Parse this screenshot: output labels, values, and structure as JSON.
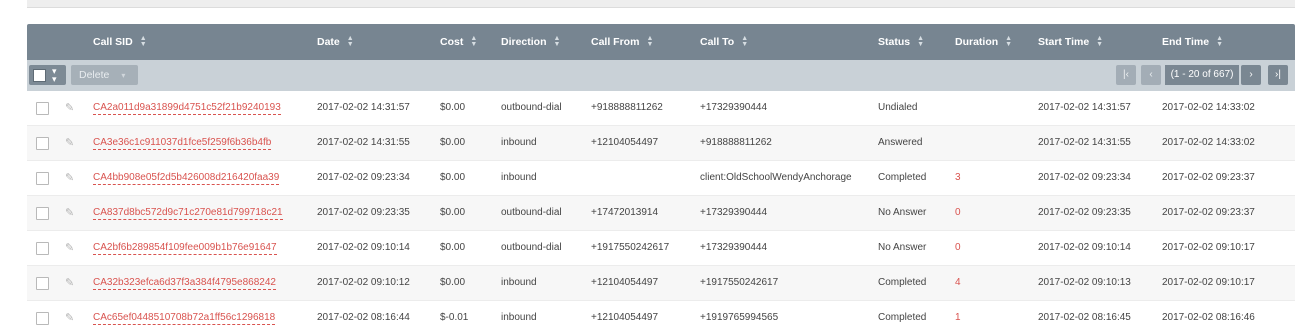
{
  "columns": {
    "call_sid": "Call SID",
    "date": "Date",
    "cost": "Cost",
    "direction": "Direction",
    "call_from": "Call From",
    "call_to": "Call To",
    "status": "Status",
    "duration": "Duration",
    "start_time": "Start Time",
    "end_time": "End Time"
  },
  "toolbar": {
    "delete_label": "Delete",
    "pagination_label": "(1 - 20 of 667)"
  },
  "icons": {
    "sort": "sort-arrows-icon",
    "edit": "pencil-icon",
    "first": "first-page-icon",
    "prev": "previous-page-icon",
    "next": "next-page-icon",
    "last": "last-page-icon"
  },
  "colors": {
    "header_bg": "#778591",
    "toolbar_bg": "#c9d1d7",
    "link": "#d9534f"
  },
  "rows": [
    {
      "sid": "CA2a011d9a31899d4751c52f21b9240193",
      "date": "2017-02-02 14:31:57",
      "cost": "$0.00",
      "direction": "outbound-dial",
      "from": "+918888811262",
      "to": "+17329390444",
      "status": "Undialed",
      "duration": "",
      "start": "2017-02-02 14:31:57",
      "end": "2017-02-02 14:33:02"
    },
    {
      "sid": "CA3e36c1c911037d1fce5f259f6b36b4fb",
      "date": "2017-02-02 14:31:55",
      "cost": "$0.00",
      "direction": "inbound",
      "from": "+12104054497",
      "to": "+918888811262",
      "status": "Answered",
      "duration": "",
      "start": "2017-02-02 14:31:55",
      "end": "2017-02-02 14:33:02"
    },
    {
      "sid": "CA4bb908e05f2d5b426008d216420faa39",
      "date": "2017-02-02 09:23:34",
      "cost": "$0.00",
      "direction": "inbound",
      "from": "",
      "to": "client:OldSchoolWendyAnchorage",
      "status": "Completed",
      "duration": "3",
      "start": "2017-02-02 09:23:34",
      "end": "2017-02-02 09:23:37"
    },
    {
      "sid": "CA837d8bc572d9c71c270e81d799718c21",
      "date": "2017-02-02 09:23:35",
      "cost": "$0.00",
      "direction": "outbound-dial",
      "from": "+17472013914",
      "to": "+17329390444",
      "status": "No Answer",
      "duration": "0",
      "start": "2017-02-02 09:23:35",
      "end": "2017-02-02 09:23:37"
    },
    {
      "sid": "CA2bf6b289854f109fee009b1b76e91647",
      "date": "2017-02-02 09:10:14",
      "cost": "$0.00",
      "direction": "outbound-dial",
      "from": "+1917550242617",
      "to": "+17329390444",
      "status": "No Answer",
      "duration": "0",
      "start": "2017-02-02 09:10:14",
      "end": "2017-02-02 09:10:17"
    },
    {
      "sid": "CA32b323efca6d37f3a384f4795e868242",
      "date": "2017-02-02 09:10:12",
      "cost": "$0.00",
      "direction": "inbound",
      "from": "+12104054497",
      "to": "+1917550242617",
      "status": "Completed",
      "duration": "4",
      "start": "2017-02-02 09:10:13",
      "end": "2017-02-02 09:10:17"
    },
    {
      "sid": "CAc65ef0448510708b72a1ff56c1296818",
      "date": "2017-02-02 08:16:44",
      "cost": "$-0.01",
      "direction": "inbound",
      "from": "+12104054497",
      "to": "+1919765994565",
      "status": "Completed",
      "duration": "1",
      "start": "2017-02-02 08:16:45",
      "end": "2017-02-02 08:16:46"
    }
  ]
}
